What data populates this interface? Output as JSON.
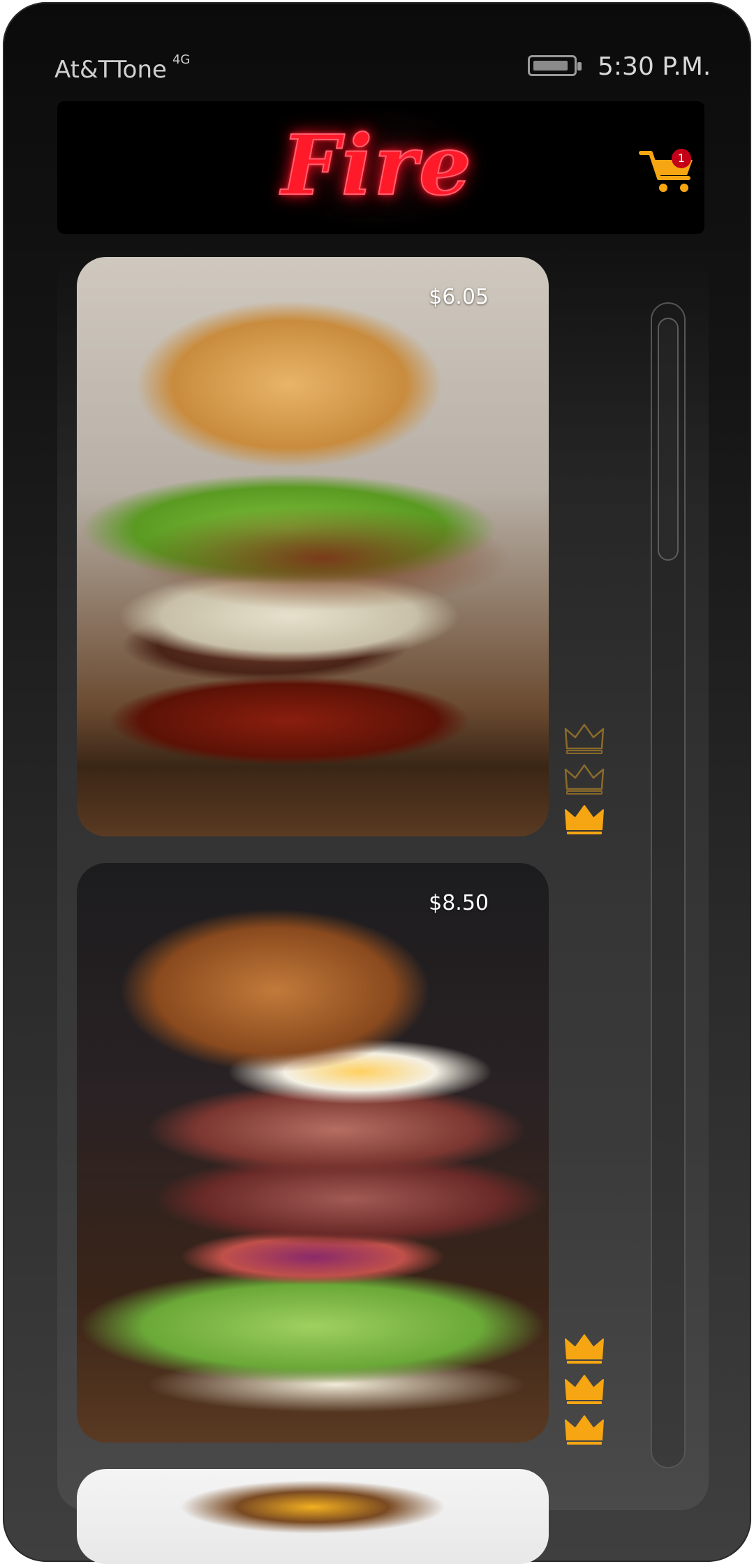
{
  "status_bar": {
    "carrier": "At&TTone",
    "network": "4G",
    "time": "5:30 P.M.",
    "battery_level": 0.9
  },
  "header": {
    "logo_text": "Fire",
    "cart_count": "1",
    "icons": {
      "cart": "shopping-cart-icon"
    }
  },
  "menu": {
    "items": [
      {
        "price": "$6.05",
        "rating": 1,
        "rating_max": 3
      },
      {
        "price": "$8.50",
        "rating": 3,
        "rating_max": 3
      }
    ]
  },
  "colors": {
    "accent_gold": "#f5a612",
    "neon_red": "#ff1a2a",
    "badge_red": "#c40018",
    "background_dark": "#0b0b0b"
  }
}
